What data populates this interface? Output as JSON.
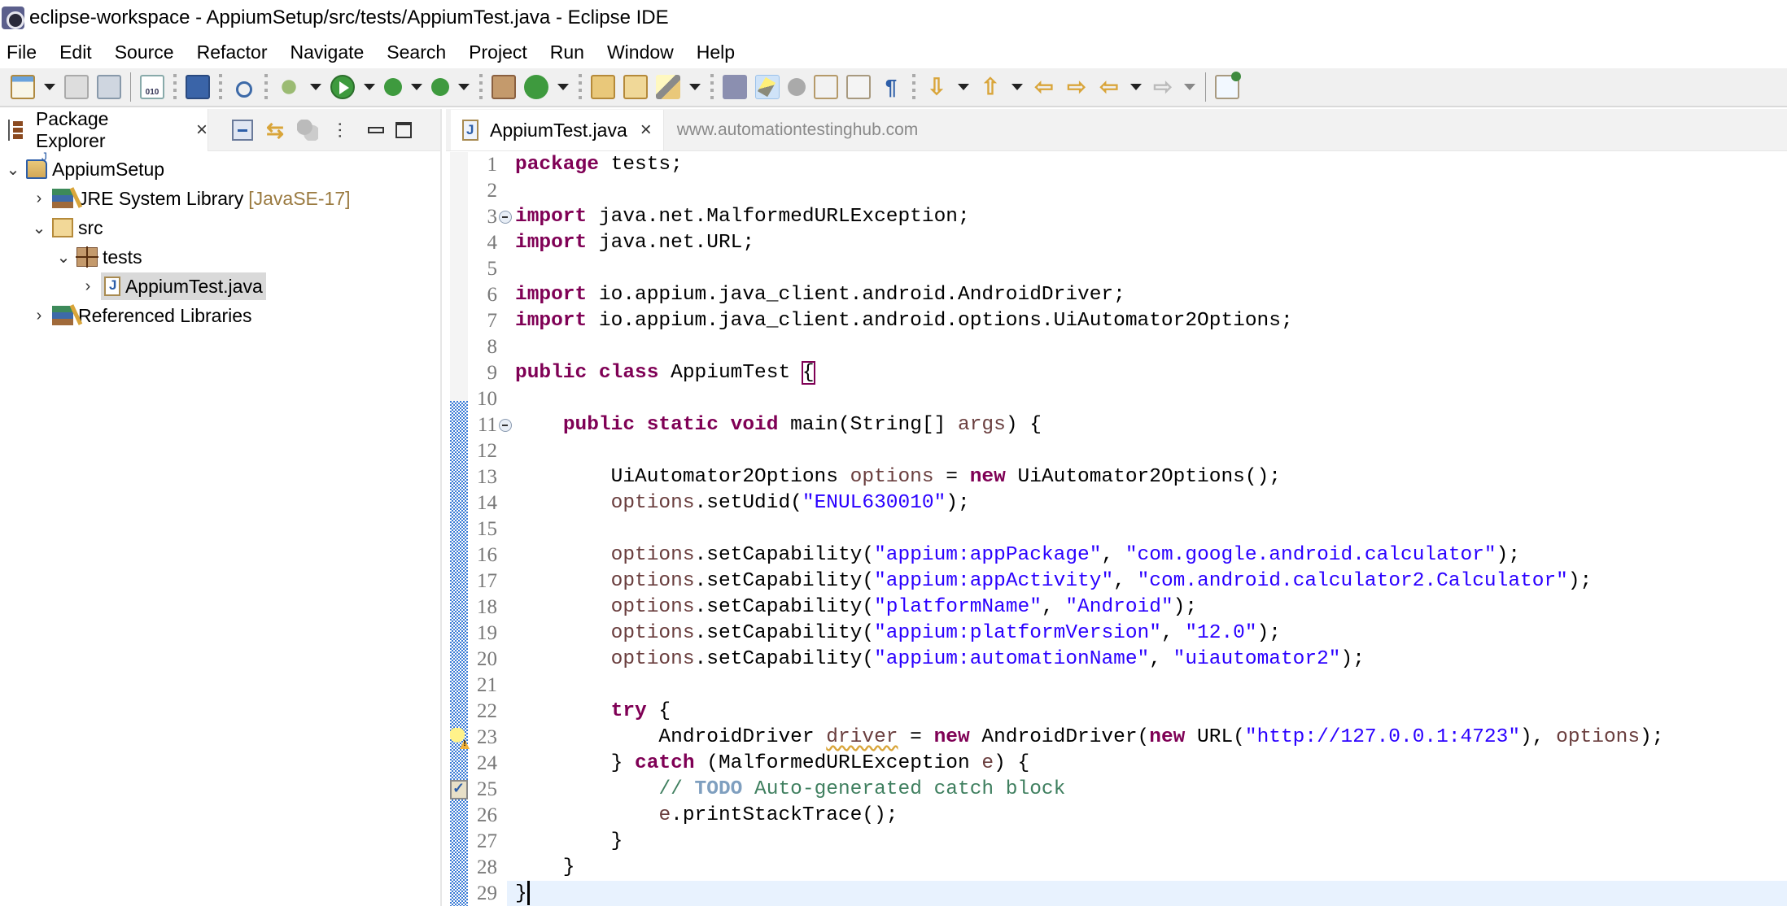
{
  "window": {
    "title": "eclipse-workspace - AppiumSetup/src/tests/AppiumTest.java - Eclipse IDE"
  },
  "menu": [
    "File",
    "Edit",
    "Source",
    "Refactor",
    "Navigate",
    "Search",
    "Project",
    "Run",
    "Window",
    "Help"
  ],
  "toolbar": {
    "icons": [
      "new-wizard-icon",
      "save-icon",
      "save-all-icon",
      "open-binary-icon",
      "open-console-icon",
      "skip-breakpoints-icon",
      "debug-icon",
      "run-icon",
      "coverage-icon",
      "external-tools-icon",
      "new-package-icon",
      "new-class-icon",
      "open-project-icon",
      "open-resource-icon",
      "search-icon",
      "open-task-icon",
      "toggle-mark-occurrences-icon",
      "toggle-breadcrumb-icon",
      "toggle-block-selection-icon",
      "toggle-word-wrap-icon",
      "show-whitespace-icon",
      "next-annotation-icon",
      "previous-annotation-icon",
      "last-edit-location-icon",
      "forward-edit-icon",
      "back-icon",
      "forward-icon",
      "pin-editor-icon"
    ],
    "glyphs": {
      "pilcrow": "¶",
      "next_edit": "⇦",
      "prev_edit": "⇨",
      "back": "⇦",
      "forward": "⇨",
      "next_ann": "⇩",
      "prev_ann": "⇧",
      "link": "⇆",
      "binary": "010"
    }
  },
  "package_explorer": {
    "title": "Package Explorer",
    "close_glyph": "×",
    "menu_glyph": "⋯",
    "tree": [
      {
        "label": "AppiumSetup",
        "expanded": true,
        "twisty": "⌄",
        "icon": "java-project-icon"
      },
      {
        "label": "JRE System Library",
        "decoration": "[JavaSE-17]",
        "expanded": false,
        "twisty": "›",
        "icon": "library-icon"
      },
      {
        "label": "src",
        "expanded": true,
        "twisty": "⌄",
        "icon": "source-folder-icon"
      },
      {
        "label": "tests",
        "expanded": true,
        "twisty": "⌄",
        "icon": "package-icon"
      },
      {
        "label": "AppiumTest.java",
        "expanded": false,
        "twisty": "›",
        "icon": "java-file-icon",
        "selected": true
      },
      {
        "label": "Referenced Libraries",
        "expanded": false,
        "twisty": "›",
        "icon": "library-icon"
      }
    ]
  },
  "editor": {
    "tab_label": "AppiumTest.java",
    "close_glyph": "×",
    "watermark": "www.automationtestinghub.com",
    "current_line": 29,
    "line_numbers": [
      "1",
      "2",
      "3",
      "4",
      "5",
      "6",
      "7",
      "8",
      "9",
      "10",
      "11",
      "12",
      "13",
      "14",
      "15",
      "16",
      "17",
      "18",
      "19",
      "20",
      "21",
      "22",
      "23",
      "24",
      "25",
      "26",
      "27",
      "28",
      "29"
    ],
    "lines": [
      [
        {
          "t": "kw",
          "v": "package"
        },
        {
          "t": "p",
          "v": " tests;"
        }
      ],
      [],
      [
        {
          "t": "kw",
          "v": "import"
        },
        {
          "t": "p",
          "v": " java.net.MalformedURLException;"
        }
      ],
      [
        {
          "t": "kw",
          "v": "import"
        },
        {
          "t": "p",
          "v": " java.net.URL;"
        }
      ],
      [],
      [
        {
          "t": "kw",
          "v": "import"
        },
        {
          "t": "p",
          "v": " io.appium.java_client.android.AndroidDriver;"
        }
      ],
      [
        {
          "t": "kw",
          "v": "import"
        },
        {
          "t": "p",
          "v": " io.appium.java_client.android.options.UiAutomator2Options;"
        }
      ],
      [],
      [
        {
          "t": "kw",
          "v": "public"
        },
        {
          "t": "p",
          "v": " "
        },
        {
          "t": "kw",
          "v": "class"
        },
        {
          "t": "p",
          "v": " AppiumTest "
        },
        {
          "t": "box",
          "v": "{"
        }
      ],
      [],
      [
        {
          "t": "p",
          "v": "    "
        },
        {
          "t": "kw",
          "v": "public"
        },
        {
          "t": "p",
          "v": " "
        },
        {
          "t": "kw",
          "v": "static"
        },
        {
          "t": "p",
          "v": " "
        },
        {
          "t": "kw",
          "v": "void"
        },
        {
          "t": "p",
          "v": " main(String[] "
        },
        {
          "t": "var",
          "v": "args"
        },
        {
          "t": "p",
          "v": ") {"
        }
      ],
      [],
      [
        {
          "t": "p",
          "v": "        UiAutomator2Options "
        },
        {
          "t": "var",
          "v": "options"
        },
        {
          "t": "p",
          "v": " = "
        },
        {
          "t": "kw",
          "v": "new"
        },
        {
          "t": "p",
          "v": " UiAutomator2Options();"
        }
      ],
      [
        {
          "t": "p",
          "v": "        "
        },
        {
          "t": "var",
          "v": "options"
        },
        {
          "t": "p",
          "v": ".setUdid("
        },
        {
          "t": "str",
          "v": "\"ENUL630010\""
        },
        {
          "t": "p",
          "v": ");"
        }
      ],
      [],
      [
        {
          "t": "p",
          "v": "        "
        },
        {
          "t": "var",
          "v": "options"
        },
        {
          "t": "p",
          "v": ".setCapability("
        },
        {
          "t": "str",
          "v": "\"appium:appPackage\""
        },
        {
          "t": "p",
          "v": ", "
        },
        {
          "t": "str",
          "v": "\"com.google.android.calculator\""
        },
        {
          "t": "p",
          "v": ");"
        }
      ],
      [
        {
          "t": "p",
          "v": "        "
        },
        {
          "t": "var",
          "v": "options"
        },
        {
          "t": "p",
          "v": ".setCapability("
        },
        {
          "t": "str",
          "v": "\"appium:appActivity\""
        },
        {
          "t": "p",
          "v": ", "
        },
        {
          "t": "str",
          "v": "\"com.android.calculator2.Calculator\""
        },
        {
          "t": "p",
          "v": ");"
        }
      ],
      [
        {
          "t": "p",
          "v": "        "
        },
        {
          "t": "var",
          "v": "options"
        },
        {
          "t": "p",
          "v": ".setCapability("
        },
        {
          "t": "str",
          "v": "\"platformName\""
        },
        {
          "t": "p",
          "v": ", "
        },
        {
          "t": "str",
          "v": "\"Android\""
        },
        {
          "t": "p",
          "v": ");"
        }
      ],
      [
        {
          "t": "p",
          "v": "        "
        },
        {
          "t": "var",
          "v": "options"
        },
        {
          "t": "p",
          "v": ".setCapability("
        },
        {
          "t": "str",
          "v": "\"appium:platformVersion\""
        },
        {
          "t": "p",
          "v": ", "
        },
        {
          "t": "str",
          "v": "\"12.0\""
        },
        {
          "t": "p",
          "v": ");"
        }
      ],
      [
        {
          "t": "p",
          "v": "        "
        },
        {
          "t": "var",
          "v": "options"
        },
        {
          "t": "p",
          "v": ".setCapability("
        },
        {
          "t": "str",
          "v": "\"appium:automationName\""
        },
        {
          "t": "p",
          "v": ", "
        },
        {
          "t": "str",
          "v": "\"uiautomator2\""
        },
        {
          "t": "p",
          "v": ");"
        }
      ],
      [],
      [
        {
          "t": "p",
          "v": "        "
        },
        {
          "t": "kw",
          "v": "try"
        },
        {
          "t": "p",
          "v": " {"
        }
      ],
      [
        {
          "t": "p",
          "v": "            AndroidDriver "
        },
        {
          "t": "warnvar",
          "v": "driver"
        },
        {
          "t": "p",
          "v": " = "
        },
        {
          "t": "kw",
          "v": "new"
        },
        {
          "t": "p",
          "v": " AndroidDriver("
        },
        {
          "t": "kw",
          "v": "new"
        },
        {
          "t": "p",
          "v": " URL("
        },
        {
          "t": "str",
          "v": "\"http://127.0.0.1:4723\""
        },
        {
          "t": "p",
          "v": "), "
        },
        {
          "t": "var",
          "v": "options"
        },
        {
          "t": "p",
          "v": ");"
        }
      ],
      [
        {
          "t": "p",
          "v": "        } "
        },
        {
          "t": "kw",
          "v": "catch"
        },
        {
          "t": "p",
          "v": " (MalformedURLException "
        },
        {
          "t": "var",
          "v": "e"
        },
        {
          "t": "p",
          "v": ") {"
        }
      ],
      [
        {
          "t": "p",
          "v": "            "
        },
        {
          "t": "cmt",
          "v": "// "
        },
        {
          "t": "todo",
          "v": "TODO"
        },
        {
          "t": "cmt",
          "v": " Auto-generated catch block"
        }
      ],
      [
        {
          "t": "p",
          "v": "            "
        },
        {
          "t": "var",
          "v": "e"
        },
        {
          "t": "p",
          "v": ".printStackTrace();"
        }
      ],
      [
        {
          "t": "p",
          "v": "        }"
        }
      ],
      [
        {
          "t": "p",
          "v": "    }"
        }
      ],
      [
        {
          "t": "p",
          "v": "}"
        },
        {
          "t": "caret",
          "v": ""
        }
      ]
    ],
    "fold_lines": [
      3,
      11
    ],
    "markers": [
      {
        "line": 23,
        "type": "warning-quickfix"
      },
      {
        "line": 25,
        "type": "task"
      }
    ]
  },
  "colors": {
    "keyword": "#7f0055",
    "string": "#2a00ff",
    "variable": "#6a3e3e",
    "comment": "#3f7f5f",
    "todo": "#7f9fbf",
    "current_line": "#e8f2fe",
    "selection": "#d9d9d9"
  }
}
